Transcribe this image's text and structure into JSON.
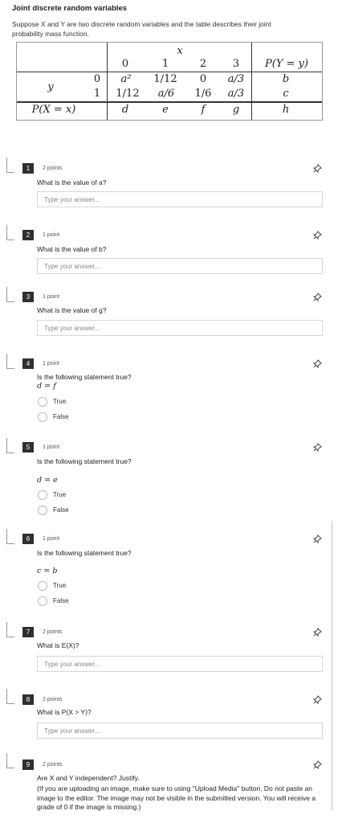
{
  "title": "Joint discrete random variables",
  "intro": "Suppose X and Y are two discrete random variables and the table describes their joint probability mass function.",
  "table": {
    "x_label": "x",
    "y_label": "y",
    "x_values": [
      "0",
      "1",
      "2",
      "3"
    ],
    "py_header": "P(Y = y)",
    "rows": [
      {
        "y": "0",
        "cells": [
          "a²",
          "1/12",
          "0",
          "a/3"
        ],
        "py": "b"
      },
      {
        "y": "1",
        "cells": [
          "1/12",
          "a/6",
          "1/6",
          "a/3"
        ],
        "py": "c"
      }
    ],
    "px_label": "P(X = x)",
    "px_values": [
      "d",
      "e",
      "f",
      "g"
    ],
    "px_total": "h"
  },
  "questions": [
    {
      "num": "1",
      "points": "2 points",
      "text": "What is the value of a?",
      "placeholder": "Type your answer..."
    },
    {
      "num": "2",
      "points": "1 point",
      "text": "What is the value of b?",
      "placeholder": "Type your answer..."
    },
    {
      "num": "3",
      "points": "1 point",
      "text": "What is the value of g?",
      "placeholder": "Type your answer..."
    },
    {
      "num": "4",
      "points": "1 point",
      "text": "Is the following statement true?",
      "eq": "d = f",
      "options": [
        "True",
        "False"
      ]
    },
    {
      "num": "5",
      "points": "1 point",
      "text": "Is the following statement true?",
      "eq": "d = e",
      "options": [
        "True",
        "False"
      ]
    },
    {
      "num": "6",
      "points": "1 point",
      "text": "Is the following statement true?",
      "eq": "c = b",
      "options": [
        "True",
        "False"
      ]
    },
    {
      "num": "7",
      "points": "2 points",
      "text": "What is E(X)?",
      "placeholder": "Type your answer..."
    },
    {
      "num": "8",
      "points": "2 points",
      "text": "What is P(X > Y)?",
      "placeholder": "Type your answer..."
    },
    {
      "num": "9",
      "points": "2 points",
      "text": "Are X and Y independent? Justify.",
      "note": "(If you are uploading an image, make sure to using \"Upload Media\" button. Do not paste an image to the editor. The image may not be visible in the submitted version. You will receive a grade of 0 if the image is missing.)"
    }
  ]
}
